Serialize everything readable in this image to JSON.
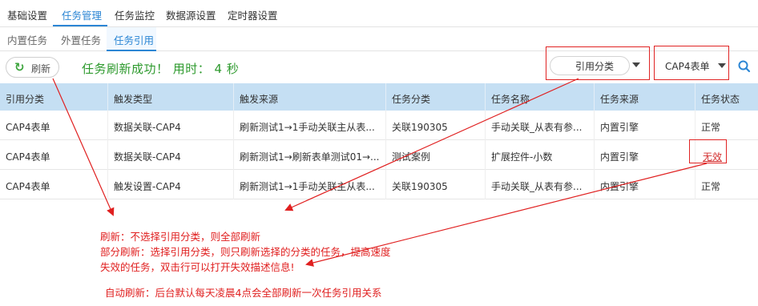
{
  "top_tabs": [
    "基础设置",
    "任务管理",
    "任务监控",
    "数据源设置",
    "定时器设置"
  ],
  "sub_tabs": [
    "内置任务",
    "外置任务",
    "任务引用"
  ],
  "toolbar": {
    "refresh_label": "刷新",
    "success_message": "任务刷新成功！ 用时： 4 秒",
    "ref_category_value": "引用分类",
    "form_type_value": "CAP4表单"
  },
  "table": {
    "columns": [
      "引用分类",
      "触发类型",
      "触发来源",
      "任务分类",
      "任务名称",
      "任务来源",
      "任务状态"
    ],
    "rows": [
      [
        "CAP4表单",
        "数据关联-CAP4",
        "刷新测试1→1手动关联主从表...",
        "关联190305",
        "手动关联_从表有参...",
        "内置引擎",
        "正常"
      ],
      [
        "CAP4表单",
        "数据关联-CAP4",
        "刷新测试1→刷新表单测试01→...",
        "测试案例",
        "扩展控件-小数",
        "内置引擎",
        "无效"
      ],
      [
        "CAP4表单",
        "触发设置-CAP4",
        "刷新测试1→1手动关联主从表...",
        "关联190305",
        "手动关联_从表有参...",
        "内置引擎",
        "正常"
      ]
    ]
  },
  "annotations": {
    "line1": "刷新：不选择引用分类，则全部刷新",
    "line2": "部分刷新：选择引用分类，则只刷新选择的分类的任务，提高速度",
    "line3": "失效的任务，双击行可以打开失效描述信息!",
    "line4": "自动刷新：后台默认每天凌晨4点会全部刷新一次任务引用关系"
  },
  "colors": {
    "accent": "#2c86d4",
    "success": "#2e9a2e",
    "annotation": "#e02020",
    "header_bg": "#c5dff3"
  }
}
